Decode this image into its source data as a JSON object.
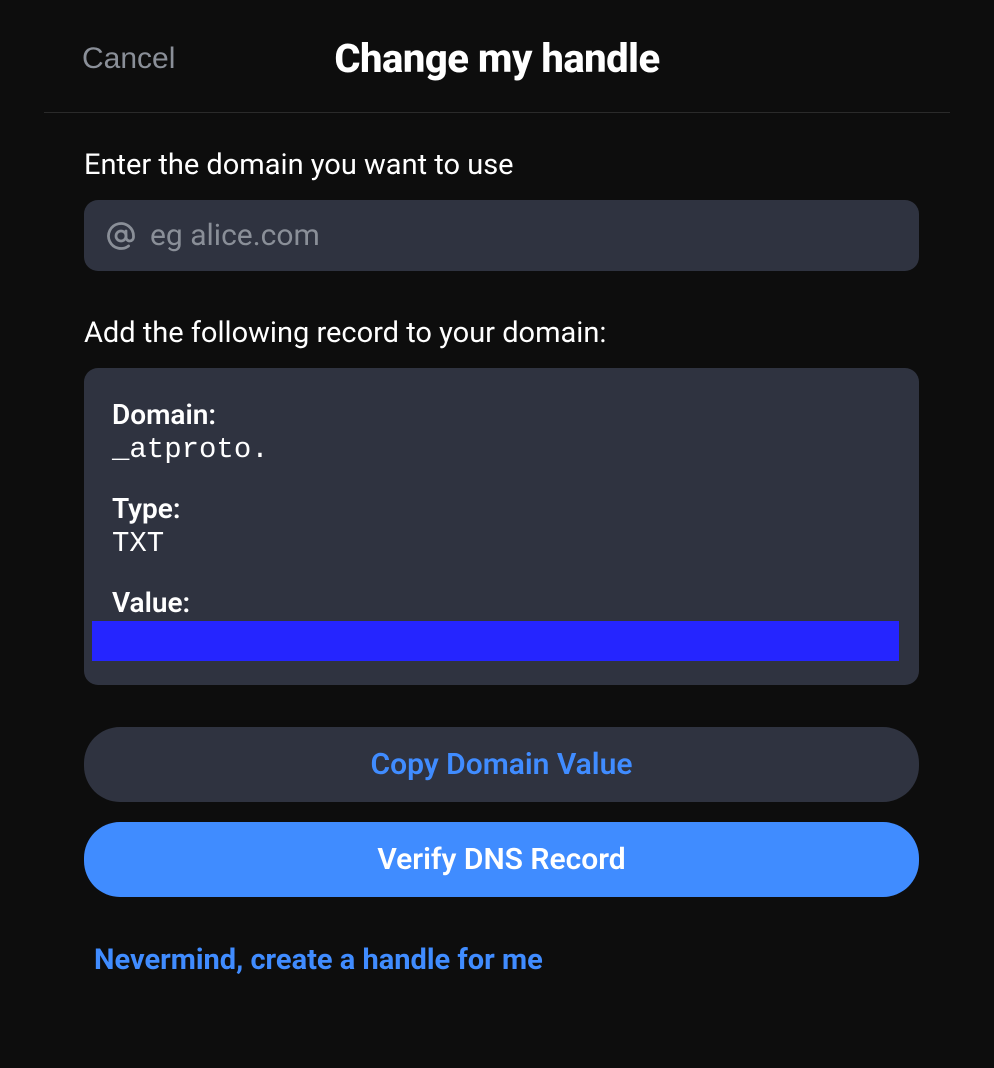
{
  "header": {
    "cancel_label": "Cancel",
    "title": "Change my handle"
  },
  "domain_section": {
    "label": "Enter the domain you want to use",
    "placeholder": "eg alice.com",
    "value": ""
  },
  "record_section": {
    "label": "Add the following record to your domain:",
    "domain_label": "Domain:",
    "domain_value": "_atproto.",
    "type_label": "Type:",
    "type_value": "TXT",
    "value_label": "Value:"
  },
  "buttons": {
    "copy_label": "Copy Domain Value",
    "verify_label": "Verify DNS Record",
    "nevermind_label": "Nevermind, create a handle for me"
  }
}
